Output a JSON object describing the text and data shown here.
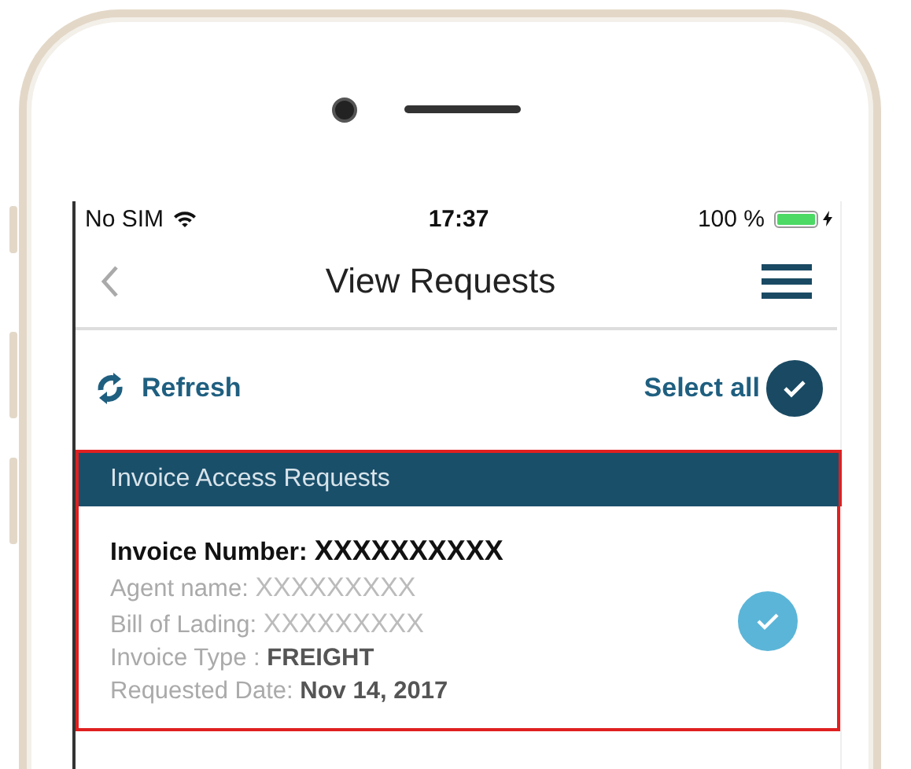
{
  "status_bar": {
    "carrier": "No SIM",
    "time": "17:37",
    "battery": "100 %"
  },
  "nav": {
    "title": "View Requests"
  },
  "toolbar": {
    "refresh": "Refresh",
    "select_all": {
      "label": "Select all",
      "checked": true
    }
  },
  "section": {
    "title": "Invoice Access Requests"
  },
  "requests": [
    {
      "highlighted": true,
      "checked": true,
      "heading_label": "Invoice Number:",
      "heading_value": "XXXXXXXXXX",
      "fields": [
        {
          "label": "Agent name:",
          "value": "XXXXXXXXX",
          "kind": "light"
        },
        {
          "label": "Bill of Lading:",
          "value": "XXXXXXXXX",
          "kind": "light"
        },
        {
          "label": "Invoice Type :",
          "value": "FREIGHT",
          "kind": "bold"
        },
        {
          "label": "Requested Date:",
          "value": "Nov 14, 2017",
          "kind": "bold"
        }
      ]
    }
  ]
}
